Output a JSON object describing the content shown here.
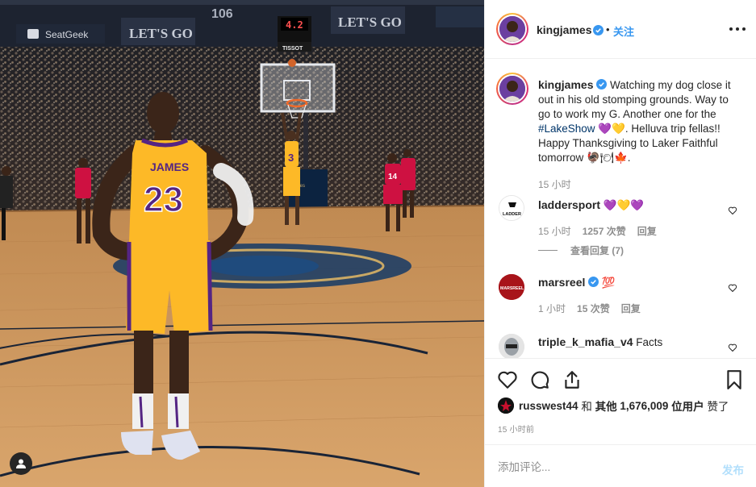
{
  "header": {
    "username": "kingjames",
    "follow_label": "关注"
  },
  "photo": {
    "jersey_name": "JAMES",
    "jersey_number": "23",
    "shooter_number": "3",
    "opponent_number": "14",
    "shot_clock": "4.2",
    "ad_1": "SeatGeek",
    "ad_2": "LET'S GO",
    "ad_3": "LET'S GO",
    "ad_4": "TISSOT",
    "section": "106"
  },
  "caption": {
    "username": "kingjames",
    "text_before": "Watching my dog close it out in his old stomping grounds. Way to go to work my G. Another one for the ",
    "hashtag": "#LakeShow",
    "text_mid": " 💜💛. Helluva trip fellas!! Happy Thanksgiving to Laker Faithful tomorrow",
    "emojis_end": "🦃🍽🍁.",
    "time": "15 小时"
  },
  "comments": [
    {
      "username": "laddersport",
      "text": "💜💛💜",
      "time": "15 小时",
      "likes": "1257 次赞",
      "reply": "回复",
      "avatar_text": "LADDER"
    },
    {
      "username": "marsreel",
      "text": "💯",
      "time": "1 小时",
      "likes": "15 次赞",
      "reply": "回复",
      "avatar_text": "MARSREEL"
    },
    {
      "username": "triple_k_mafia_v4",
      "text": "Facts",
      "time": "",
      "likes": "",
      "reply": ""
    }
  ],
  "view_replies": "查看回复 (7)",
  "likes": {
    "user": "russwest44",
    "and": "和",
    "others_label": "其他",
    "count": "1,676,009",
    "users_suffix": "位用户",
    "liked": "赞了"
  },
  "post_time": "15 小时前",
  "comment_input": {
    "placeholder": "添加评论...",
    "post_label": "发布"
  },
  "colors": {
    "link_blue": "#3897f0",
    "post_disabled": "#b2dffc",
    "hashtag": "#003569",
    "lakers_gold": "#fdb927",
    "lakers_purple": "#552583",
    "rockets_red": "#ce1141"
  }
}
